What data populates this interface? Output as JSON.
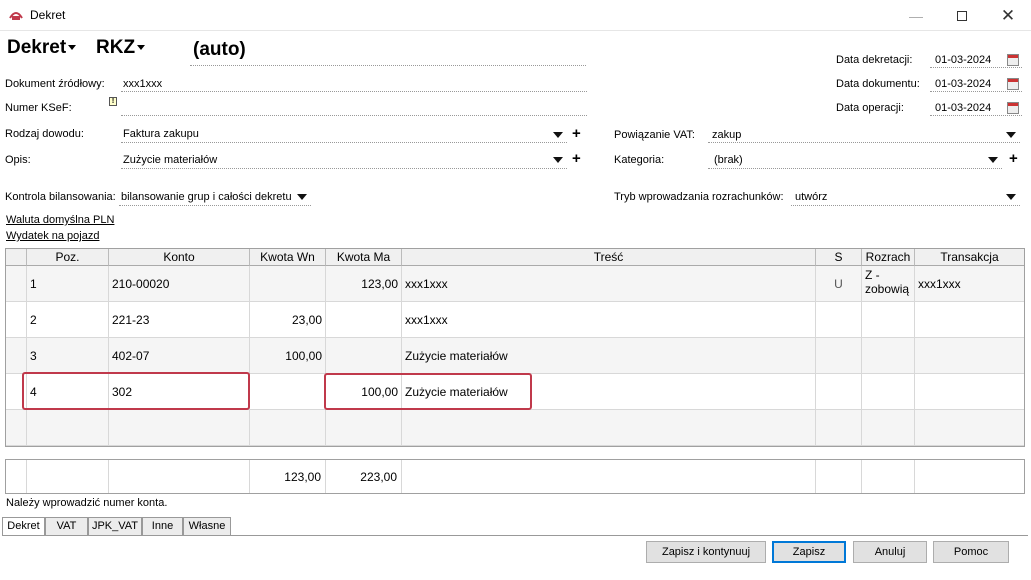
{
  "window": {
    "title": "Dekret"
  },
  "header": {
    "type_label": "Dekret",
    "register_label": "RKZ",
    "number": "(auto)"
  },
  "form": {
    "dokument_label": "Dokument źródłowy:",
    "dokument_value": "xxx1xxx",
    "ksef_label": "Numer KSeF:",
    "ksef_value": "",
    "rodzaj_label": "Rodzaj dowodu:",
    "rodzaj_value": "Faktura zakupu",
    "opis_label": "Opis:",
    "opis_value": "Zużycie materiałów",
    "kontrola_label": "Kontrola bilansowania:",
    "kontrola_value": "bilansowanie grup i całości dekretu",
    "powiazanie_label": "Powiązanie VAT:",
    "powiazanie_value": "zakup",
    "kategoria_label": "Kategoria:",
    "kategoria_value": "(brak)",
    "tryb_label": "Tryb wprowadzania rozrachunków:",
    "tryb_value": "utwórz",
    "data_dekretacji_label": "Data dekretacji:",
    "data_dekretacji_value": "01-03-2024",
    "data_dokumentu_label": "Data dokumentu:",
    "data_dokumentu_value": "01-03-2024",
    "data_operacji_label": "Data operacji:",
    "data_operacji_value": "01-03-2024",
    "waluta_link": "Waluta domyślna PLN",
    "wydatek_link": "Wydatek na pojazd"
  },
  "grid": {
    "columns": [
      "Poz.",
      "Konto",
      "Kwota Wn",
      "Kwota Ma",
      "Treść",
      "S",
      "Rozrach",
      "Transakcja"
    ],
    "rows": [
      {
        "poz": "1",
        "konto": "210-00020",
        "wn": "",
        "ma": "123,00",
        "tresc": "xxx1xxx",
        "s": "U",
        "rozrach": "Z - zobowią",
        "transakcja": "xxx1xxx"
      },
      {
        "poz": "2",
        "konto": "221-23",
        "wn": "23,00",
        "ma": "",
        "tresc": "xxx1xxx",
        "s": "",
        "rozrach": "",
        "transakcja": ""
      },
      {
        "poz": "3",
        "konto": "402-07",
        "wn": "100,00",
        "ma": "",
        "tresc": "Zużycie materiałów",
        "s": "",
        "rozrach": "",
        "transakcja": ""
      },
      {
        "poz": "4",
        "konto": "302",
        "wn": "",
        "ma": "100,00",
        "tresc": "Zużycie materiałów",
        "s": "",
        "rozrach": "",
        "transakcja": ""
      }
    ],
    "totals": {
      "wn": "123,00",
      "ma": "223,00"
    }
  },
  "status_message": "Należy wprowadzić numer konta.",
  "tabs": [
    "Dekret",
    "VAT",
    "JPK_VAT",
    "Inne",
    "Własne"
  ],
  "buttons": {
    "save_continue": "Zapisz i kontynuuj",
    "save": "Zapisz",
    "cancel": "Anuluj",
    "help": "Pomoc"
  },
  "colors": {
    "highlight": "#c0394b",
    "default_button_border": "#0078d7"
  }
}
